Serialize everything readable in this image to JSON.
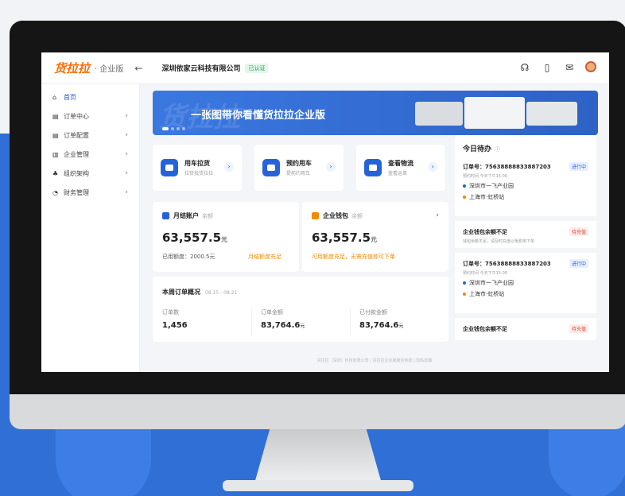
{
  "colors": {
    "accent": "#2563d9",
    "brand_orange": "#ff6a00",
    "background_blue": "#2f6fd6"
  },
  "topbar": {
    "logo": "货拉拉",
    "logo_sub": "· 企业版",
    "back_icon": "←",
    "company": "深圳依家云科技有限公司",
    "badge": "已认证",
    "icons": [
      "headset-icon",
      "document-icon",
      "message-icon",
      "avatar"
    ]
  },
  "sidebar": {
    "items": [
      {
        "label": "首页",
        "icon": "home-icon"
      },
      {
        "label": "订单中心",
        "icon": "order-icon"
      },
      {
        "label": "订单配置",
        "icon": "config-icon"
      },
      {
        "label": "企业管理",
        "icon": "building-icon"
      },
      {
        "label": "组织架构",
        "icon": "org-icon"
      },
      {
        "label": "财务管理",
        "icon": "finance-icon"
      }
    ]
  },
  "banner": {
    "bg_text": "货拉拉",
    "title": "一张图带你看懂货拉拉企业版"
  },
  "quick_actions": [
    {
      "title": "用车拉货",
      "sub": "拉货找货拉拉"
    },
    {
      "title": "预约用车",
      "sub": "提前约用车"
    },
    {
      "title": "查看物流",
      "sub": "查看运单"
    }
  ],
  "accounts": {
    "monthly": {
      "title": "月结账户",
      "muted": "余额",
      "amount": "63,557.5",
      "unit": "元",
      "credit": "已用额度：2000.5元",
      "link": "月结额度充足"
    },
    "wallet": {
      "title": "企业钱包",
      "muted": "余额",
      "amount": "63,557.5",
      "unit": "元",
      "link": "可用额度充足，无需充值即可下单"
    }
  },
  "weekly": {
    "title": "本周订单概况",
    "range": "08.15 - 08.21",
    "stats": [
      {
        "label": "订单数",
        "value": "1,456",
        "unit": ""
      },
      {
        "label": "订单金额",
        "value": "83,764.6",
        "unit": "元"
      },
      {
        "label": "已付款金额",
        "value": "83,764.6",
        "unit": "元"
      }
    ]
  },
  "todo": {
    "title": "今日待办",
    "items": [
      {
        "title": "订单号：75638888833887203",
        "tag": "进行中",
        "sub": "预约时间 今天下午15:00",
        "from": "深圳市一飞产业园",
        "to": "上海市·虹桥站"
      },
      {
        "title": "企业钱包余额不足",
        "tag": "待充值",
        "sub": "钱包余额不足，请及时充值以免影响下单",
        "from": "",
        "to": ""
      },
      {
        "title": "订单号：75638888833887203",
        "tag": "进行中",
        "sub": "预约时间 今天下午15:00",
        "from": "深圳市一飞产业园",
        "to": "上海市·虹桥站"
      },
      {
        "title": "企业钱包余额不足",
        "tag": "待充值",
        "sub": "",
        "from": "",
        "to": ""
      }
    ]
  },
  "footer": "货拉拉（深圳）科技有限公司  |  货拉拉企业版服务条款  |  隐私政策"
}
